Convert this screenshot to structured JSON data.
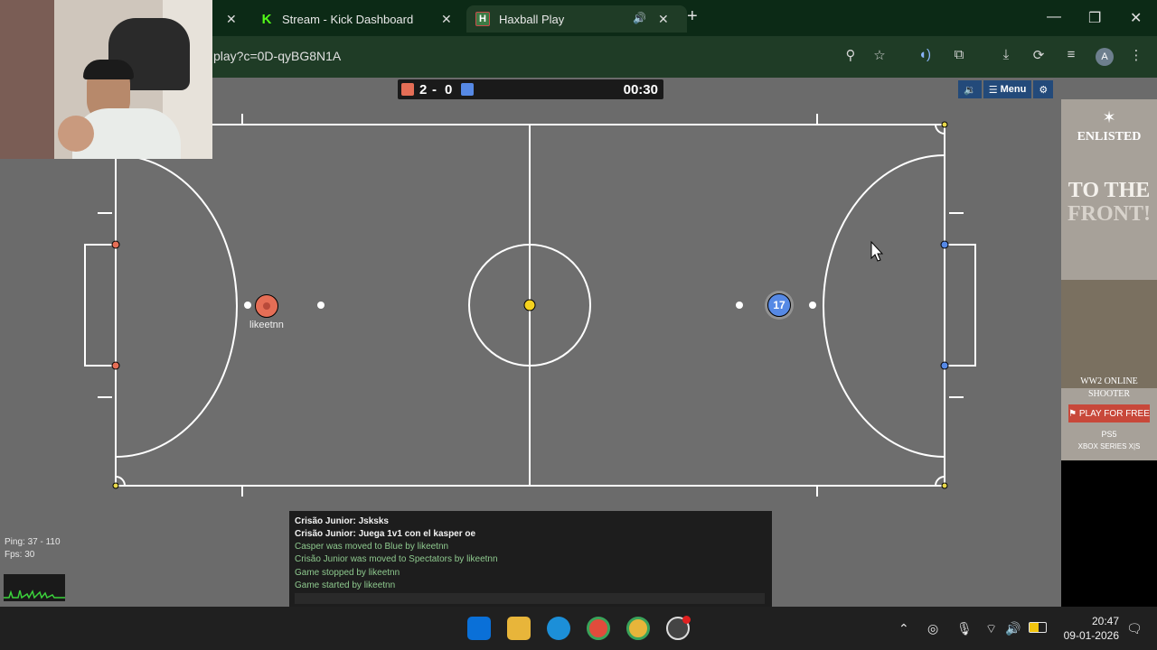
{
  "browser": {
    "tabs": [
      {
        "label": "Stream - Kick Dashboard",
        "icon": "kick-icon"
      },
      {
        "label": "Haxball Play",
        "icon": "haxball-icon"
      }
    ],
    "url": "play?c=0D-qyBG8N1A",
    "profile_initial": "A"
  },
  "game": {
    "score_red": "2",
    "score_sep": "-",
    "score_blue": "0",
    "time": "00:30",
    "menu_label": "Menu",
    "red_player_name": "likeetnn",
    "blue_player_number": "17",
    "colors": {
      "red": "#e56e56",
      "blue": "#5689e5",
      "pitch": "#6e6e6e",
      "line": "#ffffff"
    }
  },
  "chat": {
    "messages": [
      {
        "text": "Crisão Junior: Jsksks",
        "style": "white"
      },
      {
        "text": "Crisão Junior: Juega 1v1 con el kasper oe",
        "style": "white"
      },
      {
        "text": "Casper was moved to Blue by likeetnn",
        "style": "green"
      },
      {
        "text": "Crisão Junior was moved to Spectators by likeetnn",
        "style": "green"
      },
      {
        "text": "Game stopped by likeetnn",
        "style": "green"
      },
      {
        "text": "Game started by likeetnn",
        "style": "green"
      }
    ]
  },
  "stats": {
    "ping": "Ping: 37 - 110",
    "fps": "Fps: 30"
  },
  "ad": {
    "brand": "ENLISTED",
    "tagline_1": "TO THE",
    "tagline_2": "FRONT!",
    "sub_1": "WW2 ONLINE",
    "sub_2": "SHOOTER",
    "cta": "PLAY FOR FREE",
    "platform_1": "PS5",
    "platform_2": "XBOX SERIES X|S"
  },
  "taskbar": {
    "time": "20:47",
    "date": "09-01-2026"
  }
}
